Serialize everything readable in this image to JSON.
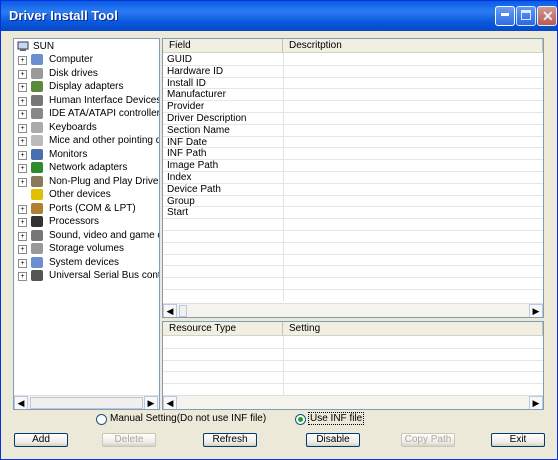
{
  "window": {
    "title": "Driver Install Tool"
  },
  "tree": {
    "root": "SUN",
    "items": [
      {
        "label": "Computer",
        "icon": "computer-icon"
      },
      {
        "label": "Disk drives",
        "icon": "disk-drive-icon"
      },
      {
        "label": "Display adapters",
        "icon": "display-adapter-icon"
      },
      {
        "label": "Human Interface Devices",
        "icon": "hid-icon"
      },
      {
        "label": "IDE ATA/ATAPI controller",
        "icon": "ide-controller-icon"
      },
      {
        "label": "Keyboards",
        "icon": "keyboard-icon"
      },
      {
        "label": "Mice and other pointing de",
        "icon": "mouse-icon"
      },
      {
        "label": "Monitors",
        "icon": "monitor-icon"
      },
      {
        "label": "Network adapters",
        "icon": "network-adapter-icon"
      },
      {
        "label": "Non-Plug and Play Drivers",
        "icon": "non-pnp-driver-icon"
      },
      {
        "label": "Other devices",
        "icon": "unknown-device-icon"
      },
      {
        "label": "Ports (COM & LPT)",
        "icon": "port-icon"
      },
      {
        "label": "Processors",
        "icon": "processor-icon"
      },
      {
        "label": "Sound, video and game co",
        "icon": "sound-icon"
      },
      {
        "label": "Storage volumes",
        "icon": "storage-volume-icon"
      },
      {
        "label": "System devices",
        "icon": "system-device-icon"
      },
      {
        "label": "Universal Serial Bus contro",
        "icon": "usb-icon"
      }
    ]
  },
  "details": {
    "columns": [
      "Field",
      "Descritption"
    ],
    "fields": [
      "GUID",
      "Hardware ID",
      "Install ID",
      "Manufacturer",
      "Provider",
      "Driver Description",
      "Section Name",
      "INF Date",
      "INF Path",
      "Image Path",
      "Index",
      "Device Path",
      "Group",
      "Start"
    ]
  },
  "resources": {
    "columns": [
      "Resource Type",
      "Setting"
    ]
  },
  "options": {
    "manual_label": "Manual Setting(Do not use INF file)",
    "inf_label": "Use INF file",
    "selected": "inf"
  },
  "buttons": {
    "add": "Add",
    "delete": "Delete",
    "refresh": "Refresh",
    "disable": "Disable",
    "copy_path": "Copy Path",
    "exit": "Exit"
  },
  "colors": {
    "titlebar": "#0a5de6",
    "face": "#ece9d8",
    "border": "#7f9db9"
  }
}
